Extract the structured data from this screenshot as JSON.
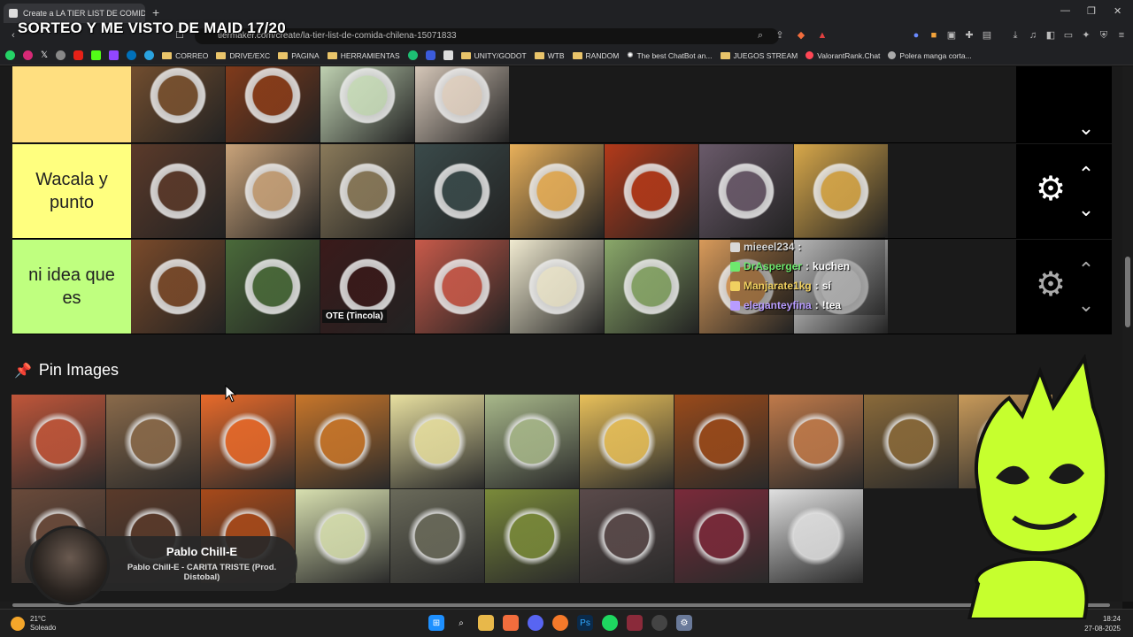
{
  "browser": {
    "tab_title": "Create a LA TIER LIST DE COMID",
    "tab_close": "✕",
    "new_tab": "+",
    "url": "tiermaker.com/create/la-tier-list-de-comida-chilena-15071833",
    "window_controls": [
      "—",
      "❐",
      "✕"
    ]
  },
  "stream_overlay": {
    "title": "SORTEO Y ME VISTO DE MAID 17/20"
  },
  "bookmarks": [
    {
      "label": "CORREO",
      "kind": "folder"
    },
    {
      "label": "DRIVE/EXC",
      "kind": "folder"
    },
    {
      "label": "PAGINA",
      "kind": "folder"
    },
    {
      "label": "HERRAMIENTAS",
      "kind": "folder"
    },
    {
      "label": "UNITY/GODOT",
      "kind": "folder"
    },
    {
      "label": "WTB",
      "kind": "folder"
    },
    {
      "label": "RANDOM",
      "kind": "folder"
    },
    {
      "label": "The best ChatBot an...",
      "kind": "link"
    },
    {
      "label": "JUEGOS STREAM",
      "kind": "folder"
    },
    {
      "label": "ValorantRank.Chat",
      "kind": "link"
    },
    {
      "label": "Polera manga corta...",
      "kind": "link"
    }
  ],
  "tiers": [
    {
      "label": "",
      "color": "#ffdf80",
      "items": [
        "#7a5230",
        "#8a3d1a",
        "#cfe3c0",
        "#e8d8c8"
      ]
    },
    {
      "label": "Wacala y punto",
      "color": "#ffff7f",
      "items": [
        "#5b3a2a",
        "#c9a37a",
        "#8a7a5a",
        "#3a4a4a",
        "#e8b05a",
        "#b33a1a",
        "#6a5a6a",
        "#d8a84a"
      ]
    },
    {
      "label": "ni idea que es",
      "color": "#bfff7f",
      "items": [
        "#7a4a2a",
        "#4a6a3a",
        "#3a1a1a",
        "#c85a4a",
        "#f0ead0",
        "#8aa86a",
        "#d89a5a",
        "#f2f2f2"
      ],
      "captions": [
        "",
        "",
        "OTE (Tincola)",
        "",
        "",
        "",
        "",
        ""
      ]
    }
  ],
  "chat": [
    {
      "user": "mieeel234",
      "message": "",
      "color": "#d8d8d8"
    },
    {
      "user": "DrAsperger",
      "message": "kuchen",
      "color": "#6ee86e"
    },
    {
      "user": "Manjarate1kg",
      "message": "sí",
      "color": "#f0d060"
    },
    {
      "user": "eleganteyfina",
      "message": "!tea",
      "color": "#b89cff"
    }
  ],
  "pin_section": {
    "title": "Pin Images",
    "icon": "pin-icon",
    "items": [
      "#c0563a",
      "#8a6a4a",
      "#e86a2a",
      "#c8762a",
      "#e8e0a0",
      "#a8b88a",
      "#e8c05a",
      "#9a4a1a",
      "#c07a4a",
      "#8a6a3a",
      "#c89a5a",
      "#6a4a3a",
      "#5a3a2a",
      "#a84a1a",
      "#d8e0b0",
      "#6a6a5a",
      "#7a8a3a",
      "#5a4a4a",
      "#7a2a3a",
      "#e0e0e0"
    ]
  },
  "music": {
    "artist": "Pablo Chill-E",
    "track": "Pablo Chill-E - CARITA TRISTE (Prod. Distobal)"
  },
  "taskbar": {
    "temperature": "21°C",
    "condition": "Soleado",
    "time": "18:24",
    "date": "27-08-2025"
  },
  "colors": {
    "accent_mascot": "#c6ff2e",
    "page_bg": "#1a1a1a",
    "control_bg": "#000000"
  }
}
